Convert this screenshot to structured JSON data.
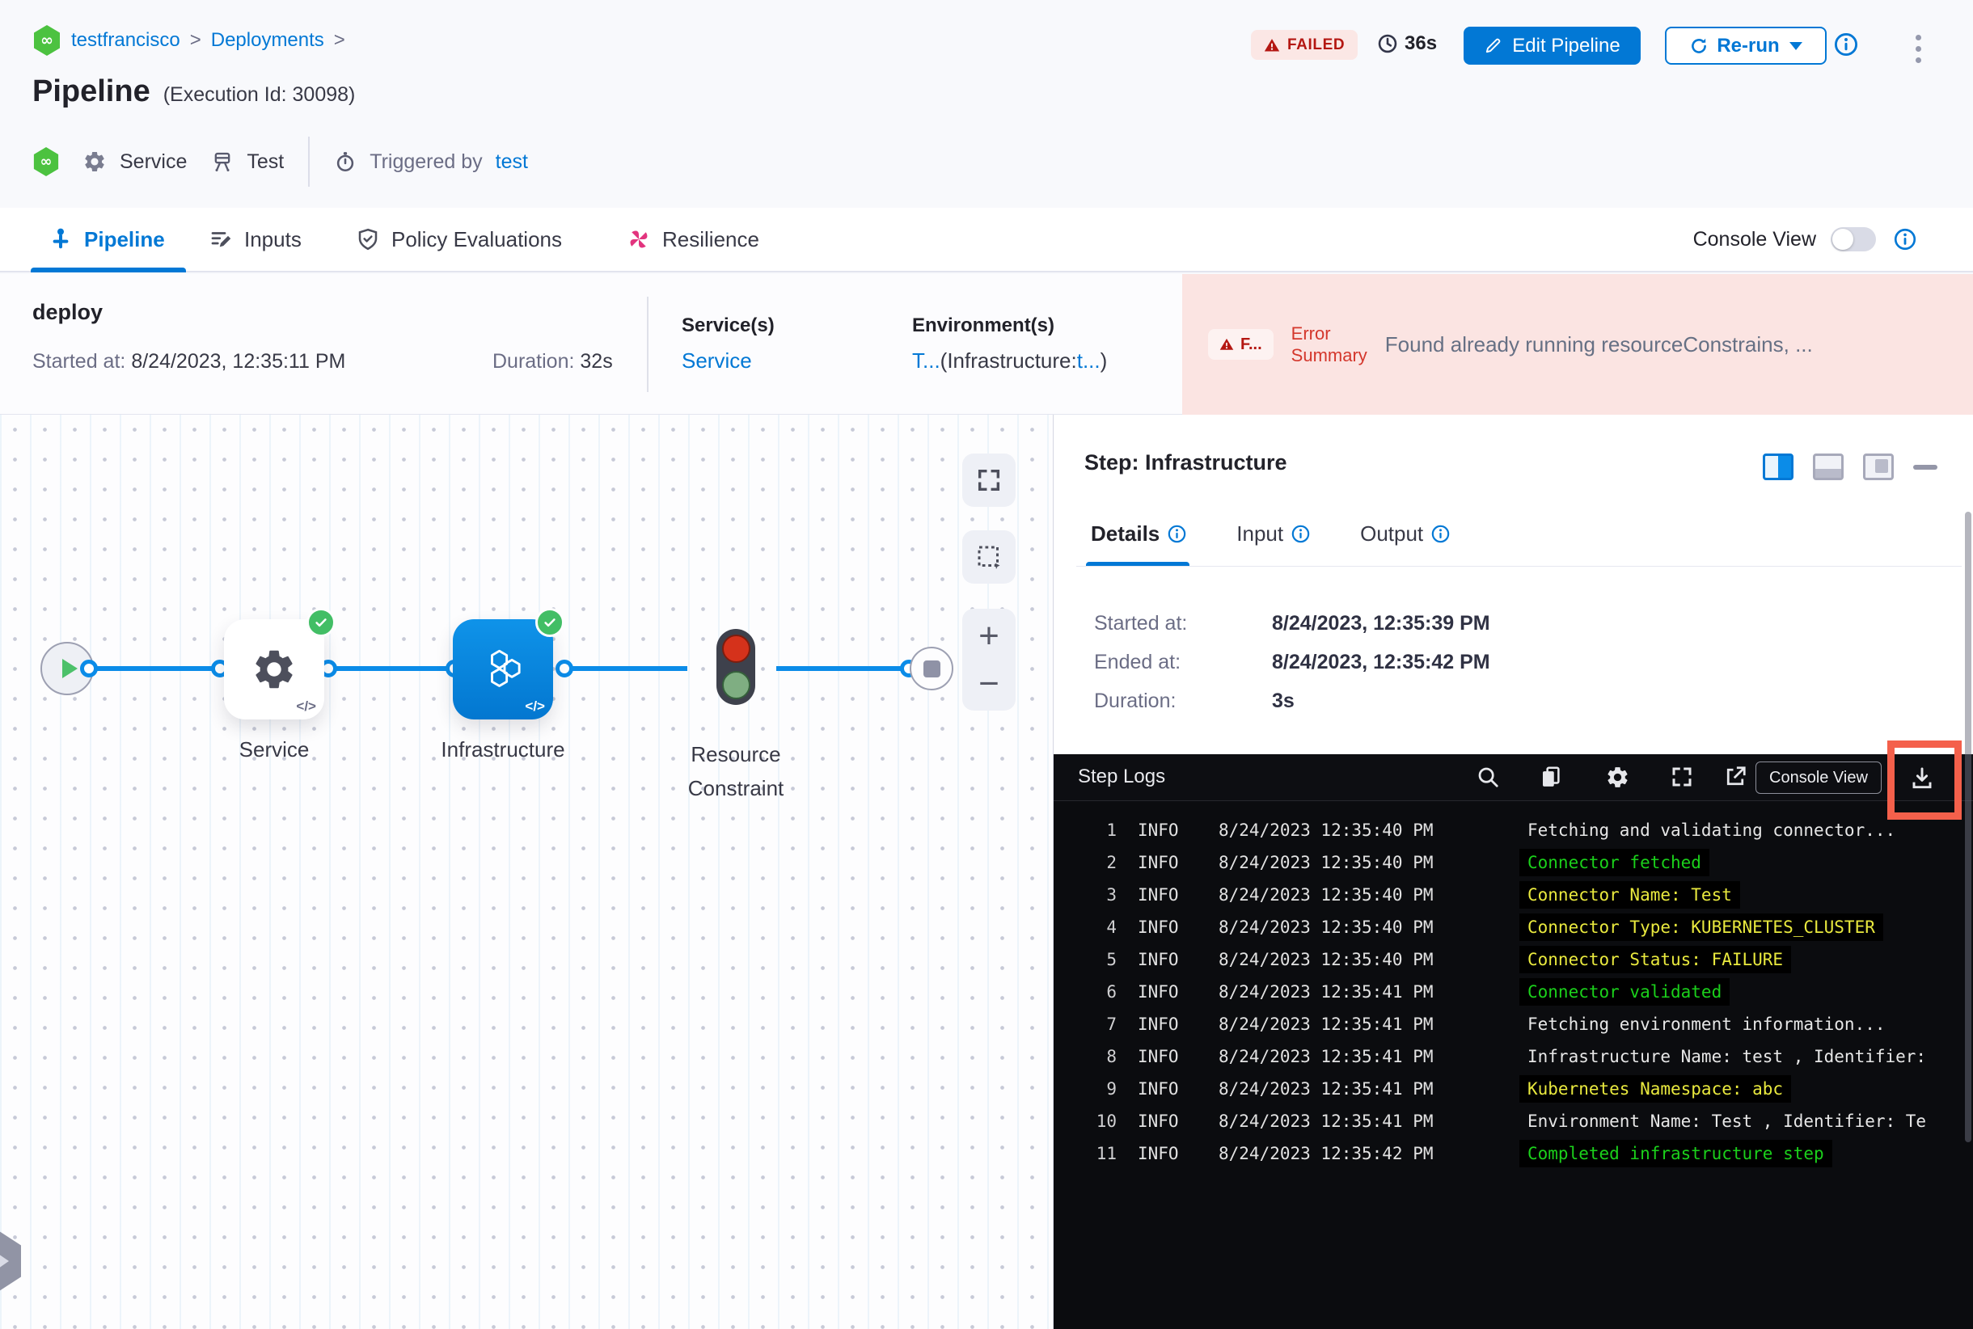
{
  "palette": {
    "accent": "#0278d5",
    "error_red": "#b41712",
    "error_bg": "#fbe4e2",
    "node_blue": "#0b8ce8",
    "log_green": "#1bd01b",
    "log_yellow": "#e9e93e",
    "annotation_red": "#f4604b"
  },
  "breadcrumb": {
    "project": "testfrancisco",
    "separator": ">",
    "section": "Deployments"
  },
  "header": {
    "title": "Pipeline",
    "execution_id": "(Execution Id: 30098)",
    "status": "FAILED",
    "total_duration": "36s",
    "edit_pipeline": "Edit Pipeline",
    "rerun": "Re-run",
    "meta": {
      "service": "Service",
      "environment": "Test",
      "triggered_by": "Triggered by",
      "trigger_user": "test"
    }
  },
  "tabs": {
    "pipeline": "Pipeline",
    "inputs": "Inputs",
    "policy": "Policy Evaluations",
    "resilience": "Resilience",
    "console_view": "Console View"
  },
  "stage": {
    "name": "deploy",
    "started_label": "Started at:",
    "started": "8/24/2023, 12:35:11 PM",
    "duration_label": "Duration:",
    "duration": "32s",
    "services_label": "Service(s)",
    "services": "Service",
    "environments_label": "Environment(s)",
    "env_part1": "T...",
    "env_part2": "(Infrastructure:",
    "env_part3": "t...",
    "env_part4": ")",
    "error_badge": "F...",
    "error_label_line1": "Error",
    "error_label_line2": "Summary",
    "error_message": "Found already running resourceConstrains, ..."
  },
  "graph": {
    "code_glyph": "</>",
    "nodes": [
      {
        "label": "Service"
      },
      {
        "label": "Infrastructure"
      },
      {
        "label": "Resource Constraint"
      }
    ]
  },
  "panel": {
    "title": "Step: Infrastructure",
    "tabs": {
      "details": "Details",
      "input": "Input",
      "output": "Output"
    },
    "details": [
      {
        "label": "Started at:",
        "value": "8/24/2023, 12:35:39 PM"
      },
      {
        "label": "Ended at:",
        "value": "8/24/2023, 12:35:42 PM"
      },
      {
        "label": "Duration:",
        "value": "3s"
      }
    ]
  },
  "logs": {
    "title": "Step Logs",
    "console_view": "Console View",
    "lines": [
      {
        "num": "1",
        "level": "INFO",
        "time": "8/24/2023 12:35:40 PM",
        "msg": "Fetching and validating connector...",
        "color": "white",
        "hl": false
      },
      {
        "num": "2",
        "level": "INFO",
        "time": "8/24/2023 12:35:40 PM",
        "msg": "Connector fetched",
        "color": "green",
        "hl": true
      },
      {
        "num": "3",
        "level": "INFO",
        "time": "8/24/2023 12:35:40 PM",
        "msg": "Connector Name: Test",
        "color": "yellow",
        "hl": true
      },
      {
        "num": "4",
        "level": "INFO",
        "time": "8/24/2023 12:35:40 PM",
        "msg": "Connector Type: KUBERNETES_CLUSTER",
        "color": "yellow",
        "hl": true
      },
      {
        "num": "5",
        "level": "INFO",
        "time": "8/24/2023 12:35:40 PM",
        "msg": "Connector Status: FAILURE",
        "color": "yellow",
        "hl": true
      },
      {
        "num": "6",
        "level": "INFO",
        "time": "8/24/2023 12:35:41 PM",
        "msg": "Connector validated",
        "color": "green",
        "hl": true
      },
      {
        "num": "7",
        "level": "INFO",
        "time": "8/24/2023 12:35:41 PM",
        "msg": "Fetching environment information...",
        "color": "white",
        "hl": false
      },
      {
        "num": "8",
        "level": "INFO",
        "time": "8/24/2023 12:35:41 PM",
        "msg": "Infrastructure Name: test , Identifier:",
        "color": "white",
        "hl": false
      },
      {
        "num": "9",
        "level": "INFO",
        "time": "8/24/2023 12:35:41 PM",
        "msg": "Kubernetes Namespace: abc",
        "color": "yellow",
        "hl": true
      },
      {
        "num": "10",
        "level": "INFO",
        "time": "8/24/2023 12:35:41 PM",
        "msg": "Environment Name: Test , Identifier: Te",
        "color": "white",
        "hl": false
      },
      {
        "num": "11",
        "level": "INFO",
        "time": "8/24/2023 12:35:42 PM",
        "msg": "Completed infrastructure step",
        "color": "green",
        "hl": true
      }
    ]
  }
}
